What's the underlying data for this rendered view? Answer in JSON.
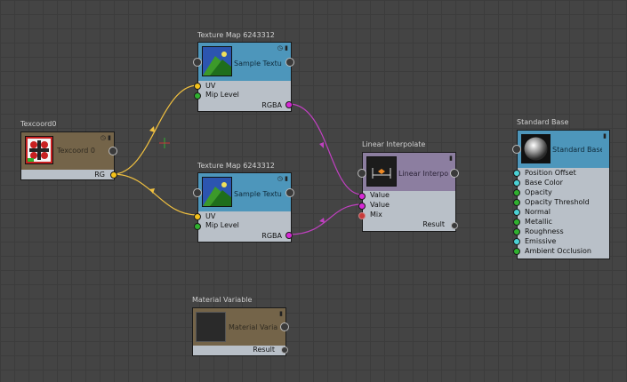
{
  "colors": {
    "canvas": "#444444",
    "blue_header": "#4d96bb",
    "brown_header": "#746449",
    "purple_header": "#8c7ea0",
    "body": "#b9c0c8",
    "wire_yellow": "#f0c040",
    "wire_magenta": "#c040c0",
    "port_yellow": "#f4c21a",
    "port_green": "#2fb02f",
    "port_magenta": "#d62ad6",
    "port_red": "#c83a3a",
    "port_cyan": "#4ad0d4"
  },
  "nodes": {
    "texcoord": {
      "title": "Texcoord0",
      "label": "Texcoord 0",
      "outputs": [
        "RG"
      ]
    },
    "texmap1": {
      "title": "Texture Map 6243312",
      "label": "Sample Texture",
      "inputs": [
        "UV",
        "Mip Level"
      ],
      "outputs": [
        "RGBA"
      ]
    },
    "texmap2": {
      "title": "Texture Map 6243312",
      "label": "Sample Texture",
      "inputs": [
        "UV",
        "Mip Level"
      ],
      "outputs": [
        "RGBA"
      ]
    },
    "lerp": {
      "title": "Linear Interpolate",
      "label": "Linear Interpolate",
      "inputs": [
        "Value",
        "Value",
        "Mix"
      ],
      "outputs": [
        "Result"
      ]
    },
    "stdbase": {
      "title": "Standard Base",
      "label": "Standard Base",
      "inputs": [
        "Position Offset",
        "Base Color",
        "Opacity",
        "Opacity Threshold",
        "Normal",
        "Metallic",
        "Roughness",
        "Emissive",
        "Ambient Occlusion"
      ],
      "input_port_types": [
        "cyan",
        "cyan",
        "green",
        "green",
        "cyan",
        "green",
        "green",
        "cyan",
        "green"
      ]
    },
    "matvar": {
      "title": "Material Variable",
      "label": "Material Variable",
      "outputs": [
        "Result"
      ]
    }
  },
  "icons": {
    "clock": "clock-icon",
    "pin": "pin-icon",
    "crosshair": "crosshair-icon"
  }
}
